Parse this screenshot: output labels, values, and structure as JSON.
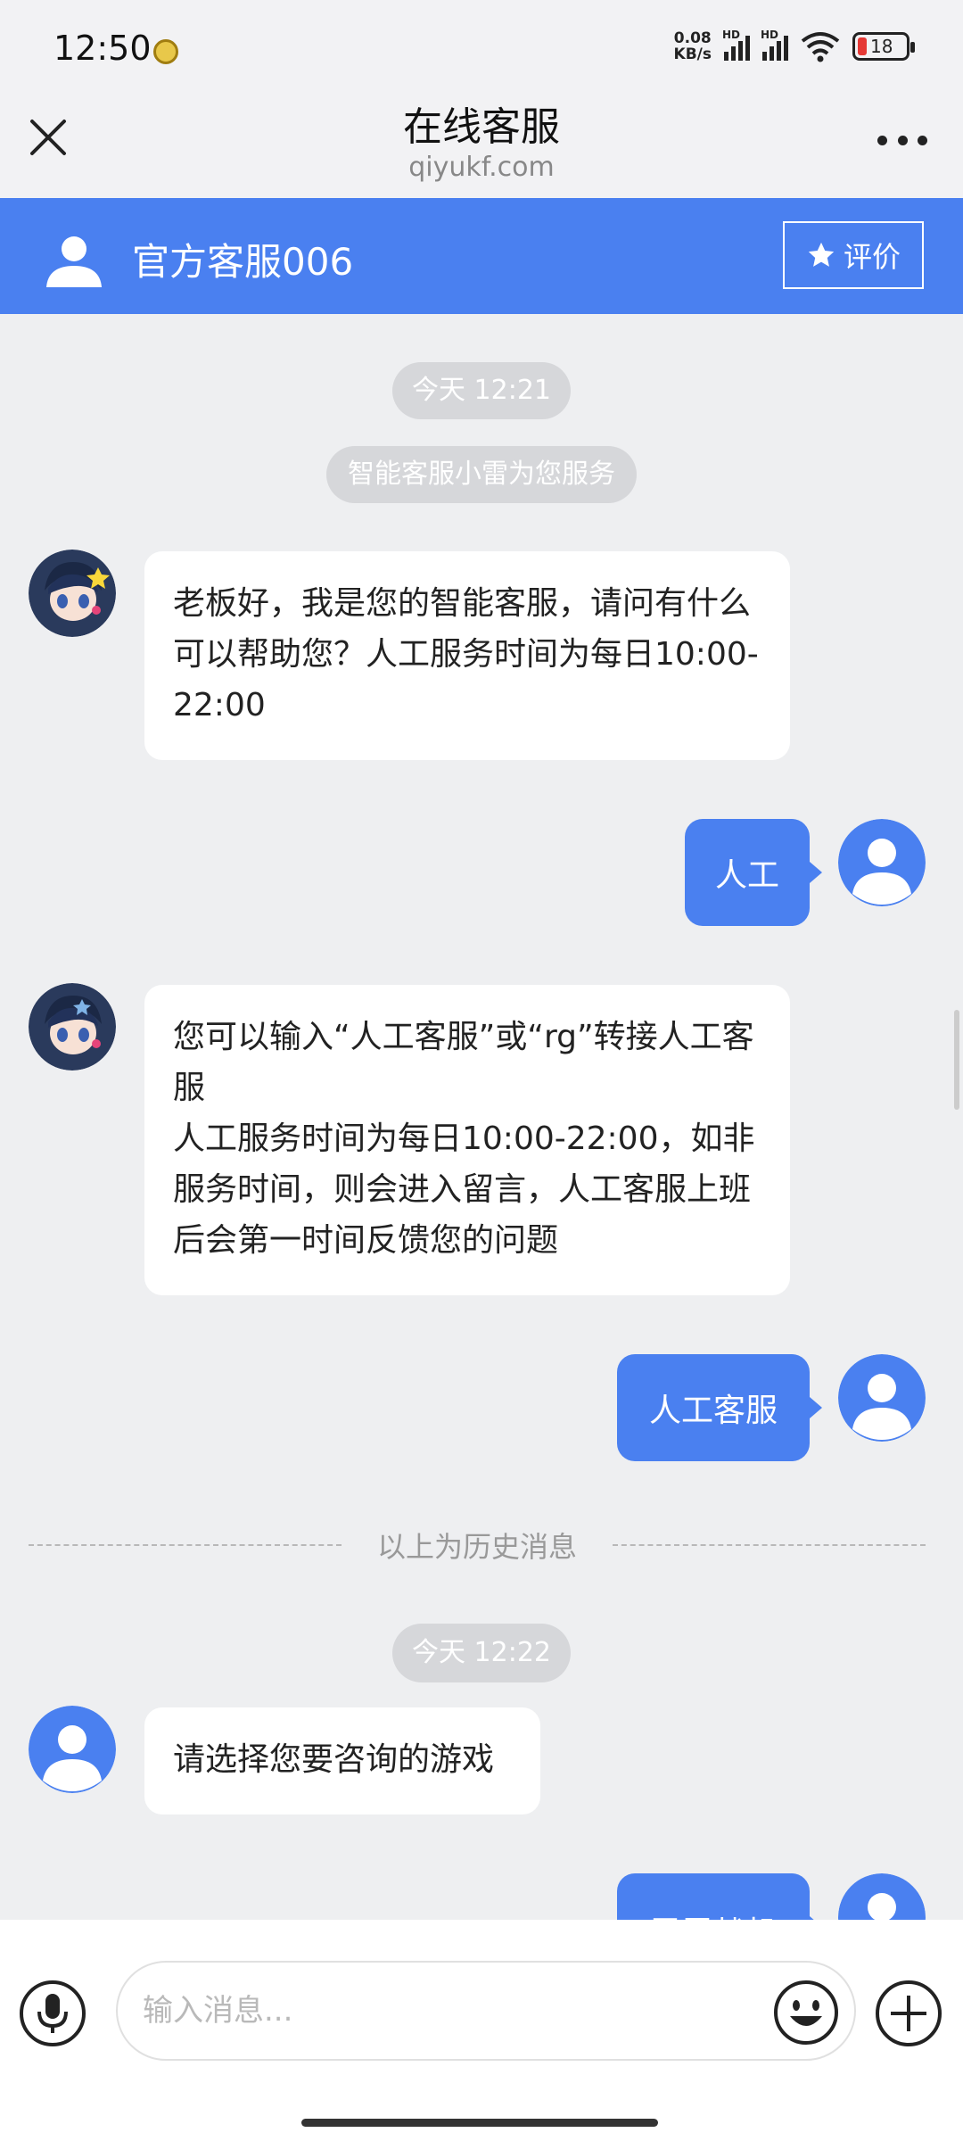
{
  "status_bar": {
    "time": "12:50",
    "net_speed_value": "0.08",
    "net_speed_unit": "KB/s",
    "signal_1_label": "HD",
    "signal_2_label": "HD",
    "battery": "18"
  },
  "nav": {
    "title": "在线客服",
    "subtitle": "qiyukf.com"
  },
  "agent": {
    "name": "官方客服006",
    "rate_label": "评价"
  },
  "chat": {
    "time_pill_1": "今天 12:21",
    "system_notice": "智能客服小雷为您服务",
    "bot_message_1": "老板好，我是您的智能客服，请问有什么可以帮助您？人工服务时间为每日10:00-22:00",
    "user_message_1": "人工",
    "bot_message_2_line_1": "您可以输入“人工客服”或“rg”转接人工客服",
    "bot_message_2_line_2": "人工服务时间为每日10:00-22:00，如非服务时间，则会进入留言，人工客服上班后会第一时间反馈您的问题",
    "user_message_2": "人工客服",
    "history_divider": "以上为历史消息",
    "time_pill_2": "今天 12:22",
    "agent_message_1": "请选择您要咨询的游戏",
    "user_message_3_partial": "雷霆战机"
  },
  "input_bar": {
    "placeholder": "输入消息..."
  },
  "colors": {
    "accent": "#4a80f0",
    "background": "#eeeff1",
    "bubble_left": "#ffffff",
    "pill": "#d6d7da"
  }
}
